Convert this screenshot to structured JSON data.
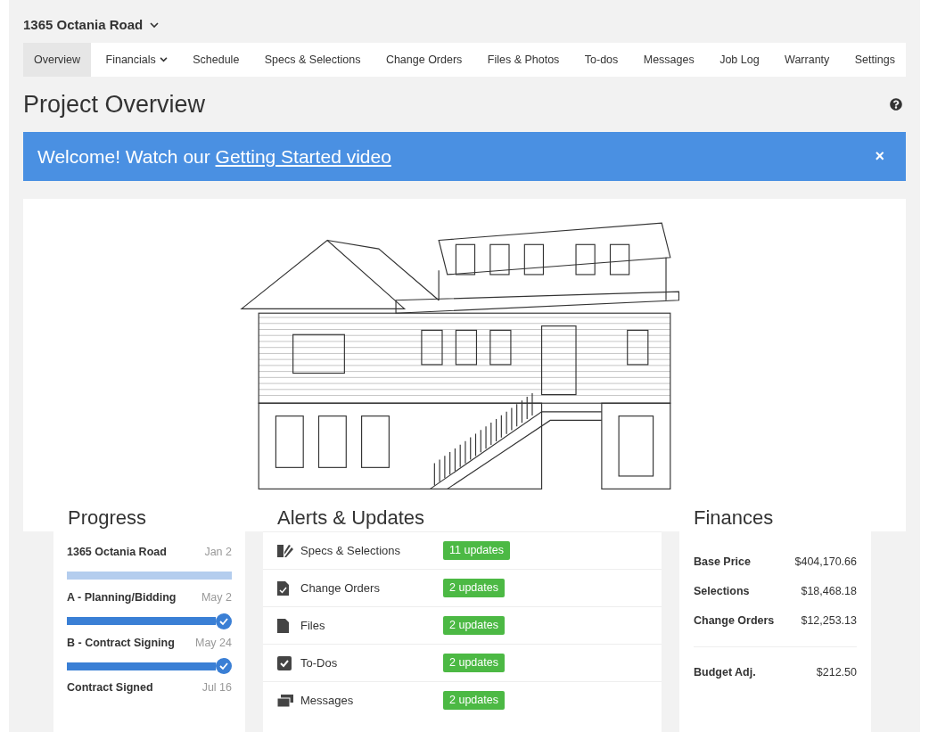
{
  "project": {
    "title": "1365 Octania Road"
  },
  "tabs": [
    {
      "label": "Overview",
      "selected": true,
      "has_menu": false
    },
    {
      "label": "Financials",
      "selected": false,
      "has_menu": true
    },
    {
      "label": "Schedule",
      "selected": false,
      "has_menu": false
    },
    {
      "label": "Specs & Selections",
      "selected": false,
      "has_menu": false
    },
    {
      "label": "Change Orders",
      "selected": false,
      "has_menu": false
    },
    {
      "label": "Files & Photos",
      "selected": false,
      "has_menu": false
    },
    {
      "label": "To-dos",
      "selected": false,
      "has_menu": false
    },
    {
      "label": "Messages",
      "selected": false,
      "has_menu": false
    },
    {
      "label": "Job Log",
      "selected": false,
      "has_menu": false
    },
    {
      "label": "Warranty",
      "selected": false,
      "has_menu": false
    },
    {
      "label": "Settings",
      "selected": false,
      "has_menu": false
    }
  ],
  "page": {
    "title": "Project Overview"
  },
  "banner": {
    "text": "Welcome! Watch our ",
    "link": "Getting Started video",
    "close": "×"
  },
  "progress": {
    "title": "Progress",
    "items": [
      {
        "name": "1365 Octania Road",
        "date": "Jan 2",
        "level": 1,
        "completed": false
      },
      {
        "name": "A - Planning/Bidding",
        "date": "May 2",
        "level": 1,
        "completed": true
      },
      {
        "name": "B - Contract Signing",
        "date": "May 24",
        "level": 1,
        "completed": true
      },
      {
        "name": "Contract Signed",
        "date": "Jul 16"
      }
    ]
  },
  "alerts": {
    "title": "Alerts & Updates",
    "items": [
      {
        "kind": "specs",
        "label": "Specs & Selections",
        "badge": "11 updates"
      },
      {
        "kind": "change",
        "label": "Change Orders",
        "badge": "2 updates"
      },
      {
        "kind": "file",
        "label": "Files",
        "badge": "2 updates"
      },
      {
        "kind": "todo",
        "label": "To-Dos",
        "badge": "2 updates"
      },
      {
        "kind": "message",
        "label": "Messages",
        "badge": "2 updates"
      }
    ]
  },
  "finances": {
    "title": "Finances",
    "groups": [
      [
        {
          "label": "Base Price",
          "value": "$404,170.66"
        },
        {
          "label": "Selections",
          "value": "$18,468.18"
        },
        {
          "label": "Change Orders",
          "value": "$12,253.13"
        }
      ],
      [
        {
          "label": "Budget Adj.",
          "value": "$212.50"
        }
      ]
    ]
  }
}
